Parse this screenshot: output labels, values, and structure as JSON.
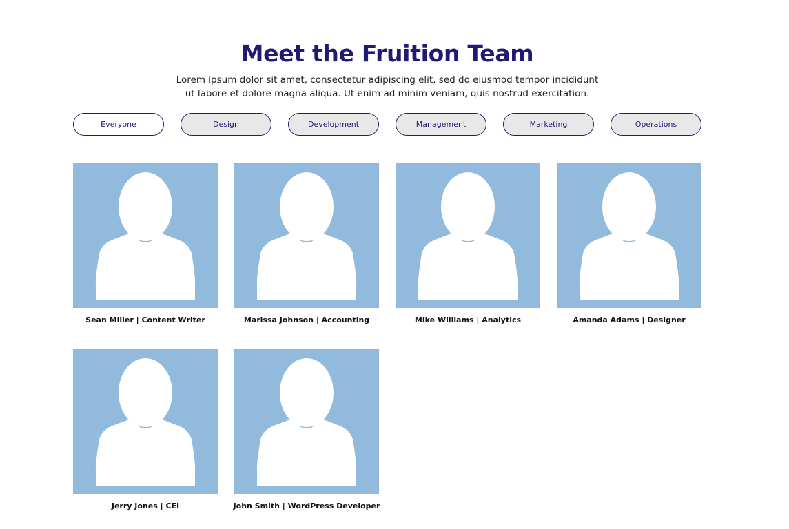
{
  "header": {
    "title": "Meet the Fruition Team",
    "intro": "Lorem ipsum dolor sit amet, consectetur adipiscing elit, sed do eiusmod tempor incididunt ut labore et dolore magna aliqua. Ut enim ad minim veniam, quis nostrud exercitation."
  },
  "filters": [
    {
      "label": "Everyone",
      "active": true
    },
    {
      "label": "Design",
      "active": false
    },
    {
      "label": "Development",
      "active": false
    },
    {
      "label": "Management",
      "active": false
    },
    {
      "label": "Marketing",
      "active": false
    },
    {
      "label": "Operations",
      "active": false
    }
  ],
  "team": [
    {
      "caption": "Sean Miller | Content Writer"
    },
    {
      "caption": "Marissa Johnson | Accounting"
    },
    {
      "caption": "Mike Williams | Analytics"
    },
    {
      "caption": "Amanda Adams | Designer"
    },
    {
      "caption": "Jerry Jones | CEI"
    },
    {
      "caption": "John Smith | WordPress Developer"
    }
  ],
  "colors": {
    "accent": "#1e1a75",
    "avatar_bg": "#91badc",
    "filter_bg": "#e8e8e8",
    "active_filter_bg": "#ffffff"
  },
  "icons": {
    "avatar": "user-silhouette-icon"
  }
}
